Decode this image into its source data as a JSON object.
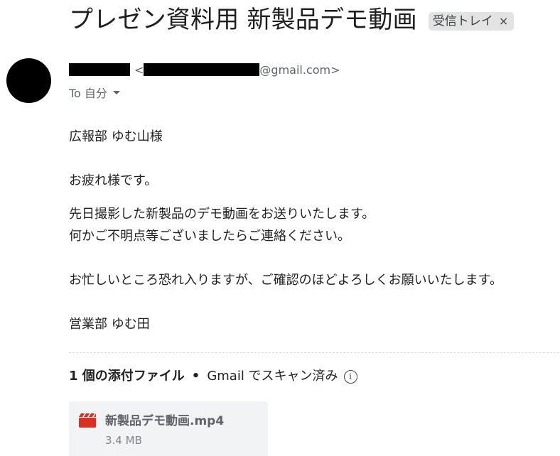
{
  "subject": "プレゼン資料用 新製品デモ動画",
  "label_chip": {
    "text": "受信トレイ",
    "close": "×"
  },
  "sender": {
    "lt": "<",
    "email_suffix": "@gmail.com>"
  },
  "recipient": {
    "text": "To 自分"
  },
  "body": {
    "greeting": "広報部 ゆむ山様",
    "line1": "お疲れ様です。",
    "line2": "先日撮影した新製品のデモ動画をお送りいたします。",
    "line3": "何かご不明点等ございましたらご連絡ください。",
    "line4": "お忙しいところ恐れ入りますが、ご確認のほどよろしくお願いいたします。",
    "signature": "営業部 ゆむ田"
  },
  "attachments": {
    "count_label": "1 個の添付ファイル",
    "separator": "•",
    "scan_label": "Gmail でスキャン済み",
    "info_glyph": "i",
    "files": [
      {
        "name": "新製品デモ動画.mp4",
        "size": "3.4 MB",
        "icon": "video-file-icon"
      }
    ]
  },
  "colors": {
    "file_icon": "#d93025",
    "chip_bg": "#e3e3e3",
    "card_bg": "#f1f3f4"
  }
}
